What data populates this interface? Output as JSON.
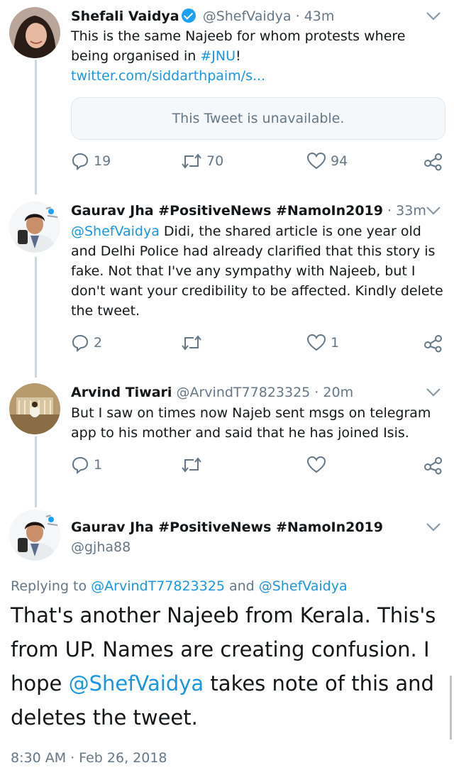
{
  "colors": {
    "link": "#1b95e0",
    "muted": "#657786",
    "verified": "#1da1f2",
    "divider": "#e1e8ed"
  },
  "tweet1": {
    "name": "Shefali Vaidya",
    "handle": "@ShefVaidya",
    "time": "43m",
    "text_part1": "This is the same Najeeb for whom protests where being organised in ",
    "hashtag": "#JNU",
    "text_part2": "!",
    "url": "twitter.com/siddarthpaim/s...",
    "quoted_unavailable": "This Tweet is unavailable.",
    "replies": "19",
    "retweets": "70",
    "likes": "94"
  },
  "tweet2": {
    "name": "Gaurav Jha #PositiveNews #NamoIn2019",
    "time": "33m",
    "mention": "@ShefVaidya",
    "text": " Didi, the shared article is one year old and Delhi Police had already clarified that this story is fake. Not that I've any sympathy with Najeeb,  but I don't want your credibility to be affected.  Kindly delete the tweet.",
    "replies": "2",
    "likes": "1"
  },
  "tweet3": {
    "name": "Arvind Tiwari",
    "handle": "@ArvindT77823325",
    "time": "20m",
    "text": "But I saw on times now Najeb  sent msgs on telegram app to his mother and said that he has joined Isis.",
    "replies": "1"
  },
  "main_tweet": {
    "name": "Gaurav Jha #PositiveNews #NamoIn2019",
    "handle": "@gjha88",
    "replying_label": "Replying to ",
    "replying_user1": "@ArvindT77823325",
    "replying_and": " and ",
    "replying_user2": "@ShefVaidya",
    "text_part1": "That's another Najeeb from Kerala.  This's from UP. Names are creating confusion.  I hope ",
    "mention": "@ShefVaidya",
    "text_part2": " takes note of this and deletes the tweet.",
    "timestamp": "8:30 AM · Feb 26, 2018"
  },
  "icons": {
    "reply": "reply-icon",
    "retweet": "retweet-icon",
    "like": "heart-icon",
    "share": "share-icon",
    "menu": "chevron-down-icon",
    "verified": "verified-badge-icon"
  }
}
